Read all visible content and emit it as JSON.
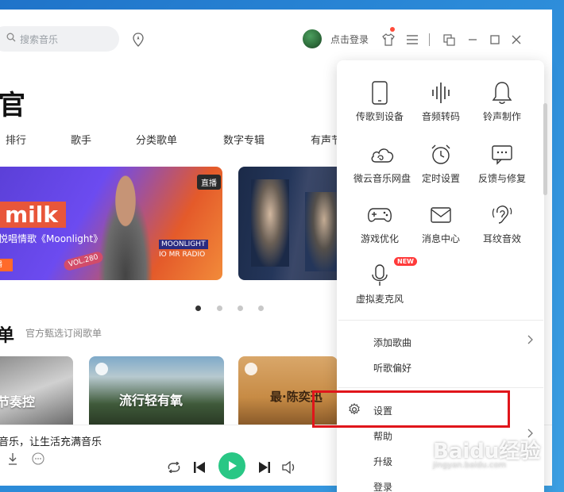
{
  "header": {
    "search_placeholder": "搜索音乐",
    "login_label": "点击登录"
  },
  "main": {
    "title": "官",
    "categories": [
      "排行",
      "歌手",
      "分类歌单",
      "数字专辑",
      "有声节"
    ],
    "banner1": {
      "badge": "直播",
      "headline": "milk",
      "subtitle": "悦唱情歌《Moonlight》",
      "tag1": "MOONLIGHT",
      "tag2": "IO MR RADIO",
      "vol": "VOL.280",
      "corner": "播"
    },
    "carousel_pages": 4,
    "carousel_active": 0,
    "section": {
      "title": "单",
      "subtitle": "官方甄选订阅歌单"
    },
    "cards": [
      "节奏控",
      "流行轻有氧",
      "最·陈奕迅"
    ]
  },
  "player": {
    "song_text": "音乐，让生活充满音乐"
  },
  "menu": {
    "grid": [
      {
        "label": "传歌到设备",
        "icon": "phone-icon"
      },
      {
        "label": "音频转码",
        "icon": "audio-wave-icon"
      },
      {
        "label": "铃声制作",
        "icon": "bell-icon"
      },
      {
        "label": "微云音乐网盘",
        "icon": "cloud-icon"
      },
      {
        "label": "定时设置",
        "icon": "alarm-clock-icon"
      },
      {
        "label": "反馈与修复",
        "icon": "feedback-icon"
      },
      {
        "label": "游戏优化",
        "icon": "gamepad-icon"
      },
      {
        "label": "消息中心",
        "icon": "mail-icon"
      },
      {
        "label": "耳纹音效",
        "icon": "ear-icon"
      },
      {
        "label": "虚拟麦克风",
        "icon": "microphone-icon",
        "badge": "NEW"
      }
    ],
    "items": [
      {
        "label": "添加歌曲",
        "submenu": true
      },
      {
        "label": "听歌偏好",
        "submenu": false
      },
      {
        "label": "设置",
        "submenu": false,
        "highlighted": true
      },
      {
        "label": "帮助",
        "submenu": true
      },
      {
        "label": "升级",
        "submenu": false
      },
      {
        "label": "登录",
        "submenu": false
      }
    ]
  },
  "watermark": {
    "brand": "Baidu经验",
    "url": "jingyan.baidu.com"
  },
  "colors": {
    "accent_green": "#29c785",
    "highlight_red": "#e0151b",
    "badge_red": "#ff3a3a"
  }
}
